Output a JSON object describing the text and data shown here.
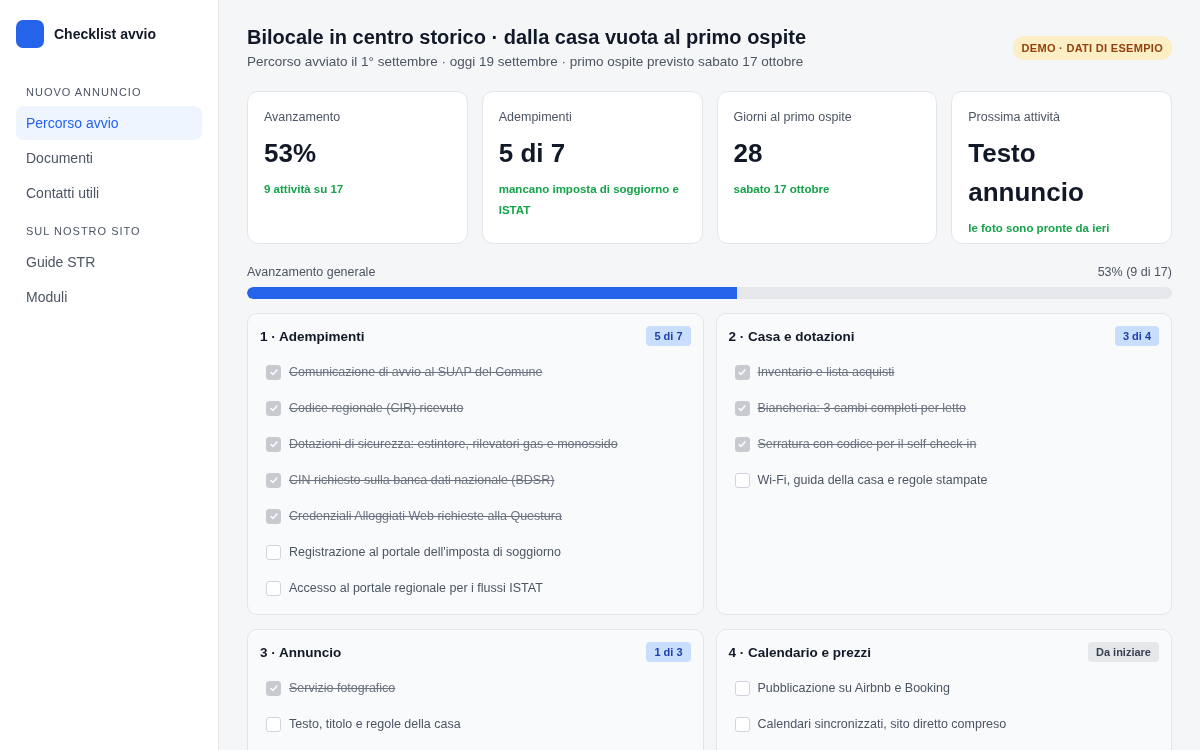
{
  "sidebar": {
    "brand": "Checklist avvio",
    "groups": [
      {
        "heading": "NUOVO ANNUNCIO",
        "items": [
          {
            "label": "Percorso avvio",
            "selected": true
          },
          {
            "label": "Documenti",
            "selected": false
          },
          {
            "label": "Contatti utili",
            "selected": false
          }
        ]
      },
      {
        "heading": "SUL NOSTRO SITO",
        "items": [
          {
            "label": "Guide STR",
            "selected": false
          },
          {
            "label": "Moduli",
            "selected": false
          }
        ]
      }
    ]
  },
  "header": {
    "title": "Bilocale in centro storico · dalla casa vuota al primo ospite",
    "subtitle": "Percorso avviato il 1° settembre · oggi 19 settembre · primo ospite previsto sabato 17 ottobre",
    "badge": "DEMO · DATI DI ESEMPIO"
  },
  "stats": [
    {
      "label": "Avanzamento",
      "value": "53%",
      "note": "9 attività su 17"
    },
    {
      "label": "Adempimenti",
      "value": "5 di 7",
      "note": "mancano imposta di soggiorno e ISTAT"
    },
    {
      "label": "Giorni al primo ospite",
      "value": "28",
      "note": "sabato 17 ottobre"
    },
    {
      "label": "Prossima attività",
      "value": "Testo annuncio",
      "note": "le foto sono pronte da ieri"
    }
  ],
  "progress": {
    "label": "Avanzamento generale",
    "reading": "53% (9 di 17)",
    "level": 0.53
  },
  "sections": [
    {
      "title": "1 · Adempimenti",
      "badge": {
        "kind": "count",
        "text": "5 di 7"
      },
      "items": [
        {
          "label": "Comunicazione di avvio al SUAP del Comune",
          "checked": true
        },
        {
          "label": "Codice regionale (CIR) ricevuto",
          "checked": true
        },
        {
          "label": "Dotazioni di sicurezza: estintore, rilevatori gas e monossido",
          "checked": true
        },
        {
          "label": "CIN richiesto sulla banca dati nazionale (BDSR)",
          "checked": true
        },
        {
          "label": "Credenziali Alloggiati Web richieste alla Questura",
          "checked": true
        },
        {
          "label": "Registrazione al portale dell'imposta di soggiorno",
          "checked": false
        },
        {
          "label": "Accesso al portale regionale per i flussi ISTAT",
          "checked": false
        }
      ]
    },
    {
      "title": "2 · Casa e dotazioni",
      "badge": {
        "kind": "count",
        "text": "3 di 4"
      },
      "items": [
        {
          "label": "Inventario e lista acquisti",
          "checked": true
        },
        {
          "label": "Biancheria: 3 cambi completi per letto",
          "checked": true
        },
        {
          "label": "Serratura con codice per il self check-in",
          "checked": true
        },
        {
          "label": "Wi-Fi, guida della casa e regole stampate",
          "checked": false
        }
      ]
    },
    {
      "title": "3 · Annuncio",
      "badge": {
        "kind": "count",
        "text": "1 di 3"
      },
      "items": [
        {
          "label": "Servizio fotografico",
          "checked": true
        },
        {
          "label": "Testo, titolo e regole della casa",
          "checked": false
        }
      ]
    },
    {
      "title": "4 · Calendario e prezzi",
      "badge": {
        "kind": "status",
        "text": "Da iniziare"
      },
      "items": [
        {
          "label": "Pubblicazione su Airbnb e Booking",
          "checked": false
        },
        {
          "label": "Calendari sincronizzati, sito diretto compreso",
          "checked": false
        }
      ]
    }
  ]
}
